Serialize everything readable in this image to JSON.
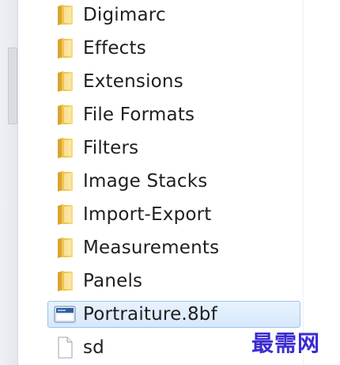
{
  "files": {
    "items": [
      {
        "name": "Digimarc",
        "type": "folder"
      },
      {
        "name": "Effects",
        "type": "folder"
      },
      {
        "name": "Extensions",
        "type": "folder"
      },
      {
        "name": "File Formats",
        "type": "folder"
      },
      {
        "name": "Filters",
        "type": "folder"
      },
      {
        "name": "Image Stacks",
        "type": "folder"
      },
      {
        "name": "Import-Export",
        "type": "folder"
      },
      {
        "name": "Measurements",
        "type": "folder"
      },
      {
        "name": "Panels",
        "type": "folder"
      },
      {
        "name": "Portraiture.8bf",
        "type": "plugin-file",
        "selected": true
      },
      {
        "name": "sd",
        "type": "file"
      }
    ]
  },
  "watermark": {
    "text": "最需网"
  },
  "colors": {
    "folder": "#f2c94c",
    "selection": "#d7e8fb",
    "selection_border": "#9cc3ec",
    "watermark": "#3b2bd0"
  }
}
